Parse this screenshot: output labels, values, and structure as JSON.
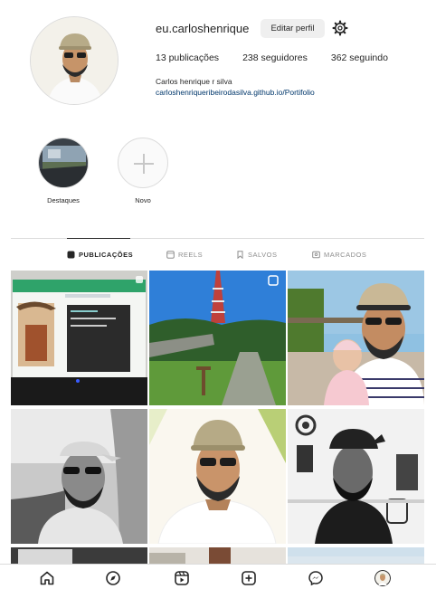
{
  "profile": {
    "username": "eu.carloshenrique",
    "edit_label": "Editar perfil",
    "posts_count": "13 publicações",
    "followers_count": "238 seguidores",
    "following_count": "362 seguindo",
    "full_name": "Carlos henrique r silva",
    "link": "carloshenriqueribeirodasilva.github.io/Portifolio"
  },
  "highlights": [
    {
      "label": "Destaques"
    },
    {
      "label": "Novo"
    }
  ],
  "tabs": [
    {
      "label": "PUBLICAÇÕES",
      "icon": "grid-icon",
      "active": true
    },
    {
      "label": "REELS",
      "icon": "reels-icon",
      "active": false
    },
    {
      "label": "SALVOS",
      "icon": "bookmark-icon",
      "active": false
    },
    {
      "label": "MARCADOS",
      "icon": "tagged-icon",
      "active": false
    }
  ],
  "posts": [
    {
      "kind": "laptop screen photo"
    },
    {
      "kind": "park with tower",
      "multi": true
    },
    {
      "kind": "selfie with baby"
    },
    {
      "kind": "car selfie black and white"
    },
    {
      "kind": "selfie with cap"
    },
    {
      "kind": "black and white wall"
    }
  ],
  "bottom_nav": [
    "home-icon",
    "explore-icon",
    "reels-icon",
    "new-post-icon",
    "messenger-icon",
    "profile-avatar"
  ],
  "colors": {
    "accent_link": "#00376b",
    "border": "#dbdbdb",
    "button_bg": "#efefef",
    "muted": "#8e8e8e"
  }
}
